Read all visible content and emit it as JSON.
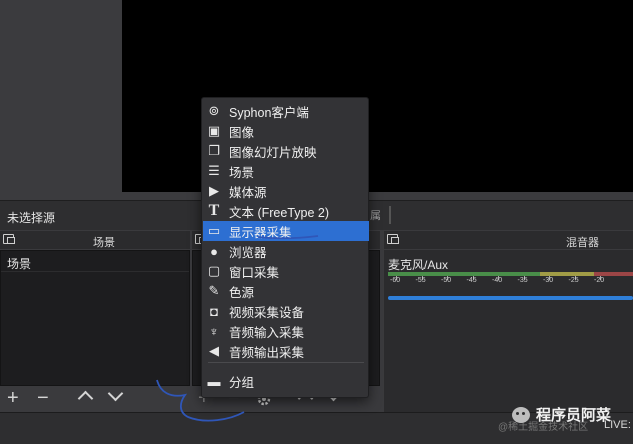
{
  "source_bar": {
    "label": "未选择源",
    "props_hint": "属"
  },
  "docks": {
    "scenes_title": "场景",
    "mixer_title": "混音器"
  },
  "scenes": {
    "items": [
      "场景"
    ]
  },
  "mixer": {
    "channel_name": "麦克风/Aux",
    "tick_labels": [
      "-60",
      "-55",
      "-50",
      "-45",
      "-40",
      "-35",
      "-30",
      "-25",
      "-20"
    ]
  },
  "toolbar": {
    "add": "+",
    "remove": "−"
  },
  "context_menu": {
    "items": [
      {
        "label": "Syphon客户端",
        "icon": "gamepad-icon"
      },
      {
        "label": "图像",
        "icon": "image-icon"
      },
      {
        "label": "图像幻灯片放映",
        "icon": "slideshow-icon"
      },
      {
        "label": "场景",
        "icon": "list-icon"
      },
      {
        "label": "媒体源",
        "icon": "play-icon"
      },
      {
        "label": "文本 (FreeType 2)",
        "icon": "text-icon"
      },
      {
        "label": "显示器采集",
        "icon": "monitor-icon",
        "selected": true
      },
      {
        "label": "浏览器",
        "icon": "globe-icon"
      },
      {
        "label": "窗口采集",
        "icon": "window-icon"
      },
      {
        "label": "色源",
        "icon": "brush-icon"
      },
      {
        "label": "视频采集设备",
        "icon": "camera-icon"
      },
      {
        "label": "音频输入采集",
        "icon": "microphone-icon"
      },
      {
        "label": "音频输出采集",
        "icon": "speaker-icon"
      },
      {
        "label": "分组",
        "icon": "folder-icon"
      }
    ]
  },
  "status": {
    "live": "LIVE:",
    "faded": "@稀土掘金技术社区"
  },
  "watermark": {
    "text": "程序员阿菜"
  },
  "colors": {
    "accent": "#2d6fd2",
    "ink": "#2f56b8"
  }
}
